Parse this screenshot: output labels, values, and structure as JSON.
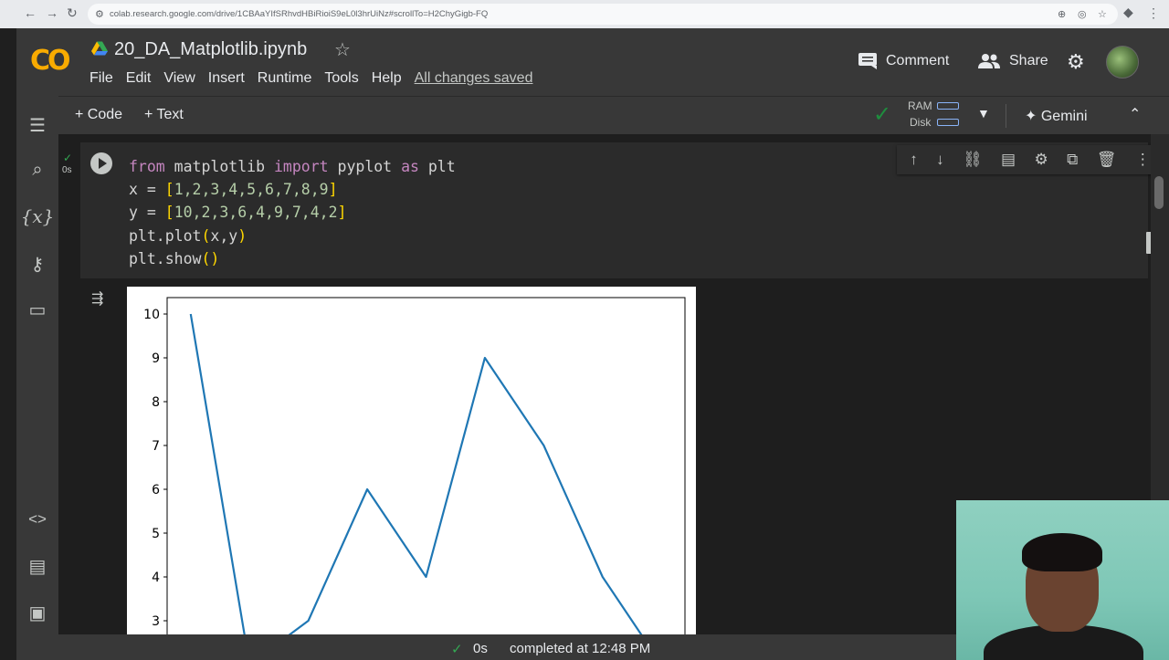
{
  "browser": {
    "url": "colab.research.google.com/drive/1CBAaYIfSRhvdHBiRioiS9eL0l3hrUiNz#scrollTo=H2ChyGigb-FQ"
  },
  "header": {
    "logo": "CO",
    "notebook_title": "20_DA_Matplotlib.ipynb",
    "menu": [
      "File",
      "Edit",
      "View",
      "Insert",
      "Runtime",
      "Tools",
      "Help"
    ],
    "saved_status": "All changes saved",
    "comment_label": "Comment",
    "share_label": "Share"
  },
  "toolbar": {
    "add_code": "+ Code",
    "add_text": "+ Text",
    "ram_label": "RAM",
    "disk_label": "Disk",
    "gemini_label": "Gemini"
  },
  "cell": {
    "exec_time": "0s",
    "code_lines": [
      "from matplotlib import pyplot as plt",
      "x = [1,2,3,4,5,6,7,8,9]",
      "y = [10,2,3,6,4,9,7,4,2]",
      "plt.plot(x,y)",
      "plt.show()"
    ]
  },
  "chart_data": {
    "type": "line",
    "x": [
      1,
      2,
      3,
      4,
      5,
      6,
      7,
      8,
      9
    ],
    "series": [
      {
        "values": [
          10,
          2,
          3,
          6,
          4,
          9,
          7,
          4,
          2
        ],
        "color": "#1f77b4"
      }
    ],
    "yticks": [
      "10",
      "9",
      "8",
      "7",
      "6",
      "5",
      "4",
      "3"
    ],
    "ylim": [
      1.6,
      10.4
    ],
    "xlim": [
      0.6,
      9.4
    ]
  },
  "status": {
    "exec_time": "0s",
    "completed_text": "completed at 12:48 PM"
  },
  "colors": {
    "accent_green": "#1e8e3e",
    "logo_orange": "#f9ab00",
    "line_blue": "#1f77b4"
  }
}
